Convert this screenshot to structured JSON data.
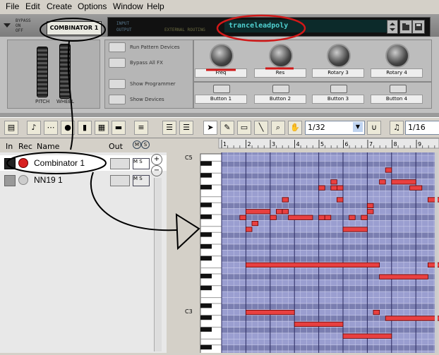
{
  "menu": {
    "items": [
      "File",
      "Edit",
      "Create",
      "Options",
      "Window",
      "Help"
    ]
  },
  "device": {
    "name_plate": "COMBINATOR 1",
    "patch_name": "tranceleadpoly",
    "lcd_labels": [
      "BYPASS",
      "ON",
      "OFF",
      "INPUT",
      "OUTPUT",
      "EXTERNAL ROUTING"
    ],
    "pitch_label": "PITCH",
    "wheel_label": "WHEEL",
    "buttons": [
      "Run Pattern Devices",
      "Bypass All FX",
      "Show Programmer",
      "Show Devices"
    ],
    "knobs": [
      "Freq",
      "Res",
      "Rotary 3",
      "Rotary 4"
    ],
    "pads": [
      "Button 1",
      "Button 2",
      "Button 3",
      "Button 4"
    ]
  },
  "toolbar": {
    "quantize_value": "1/32",
    "grid_value": "1/16"
  },
  "tracks": {
    "headers": {
      "in": "In",
      "rec": "Rec",
      "name": "Name",
      "out": "Out",
      "m": "M",
      "s": "S"
    },
    "rows": [
      {
        "name": "Combinator 1"
      },
      {
        "name": "NN19 1"
      }
    ]
  },
  "piano_roll": {
    "ruler_bars": [
      "1",
      "2",
      "3",
      "4",
      "5",
      "6",
      "7",
      "8",
      "9"
    ],
    "key_labels": [
      "C5",
      "C3"
    ],
    "note_color": "#e84040",
    "grid_color": "#8a8ec0"
  },
  "annotation_color": "#d01818"
}
